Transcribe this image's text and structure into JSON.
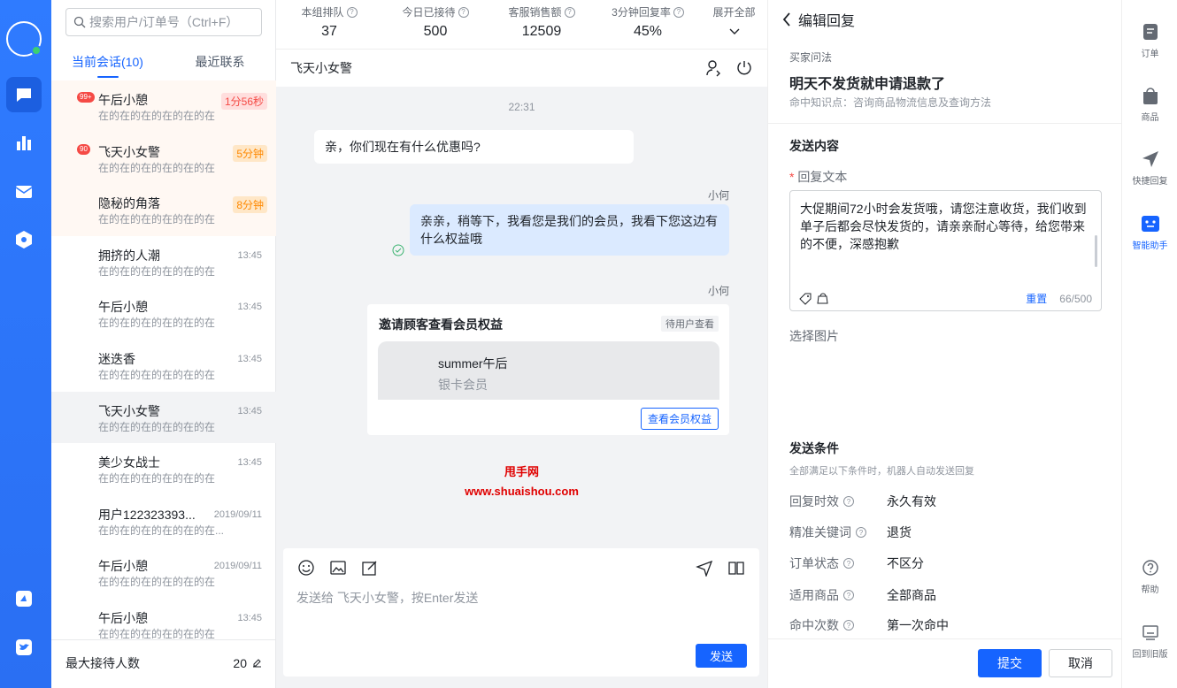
{
  "nav": {
    "icons": [
      "avatar",
      "chat-icon",
      "chart-icon",
      "mail-icon",
      "hexagon-icon",
      "app-icon",
      "bird-icon"
    ]
  },
  "conversations": {
    "search_placeholder": "搜索用户/订单号（Ctrl+F）",
    "tabs": [
      "当前会话(10)",
      "最近联系"
    ],
    "items": [
      {
        "badge": "99+",
        "name": "午后小憩",
        "sub": "在的在的在的在的在的在",
        "wait": "1分56秒",
        "wait_type": "red"
      },
      {
        "badge": "90",
        "name": "飞天小女警",
        "sub": "在的在的在的在的在的在",
        "wait": "5分钟",
        "wait_type": "orange"
      },
      {
        "name": "隐秘的角落",
        "sub": "在的在的在的在的在的在",
        "wait": "8分钟",
        "wait_type": "orange"
      },
      {
        "name": "拥挤的人潮",
        "sub": "在的在的在的在的在的在",
        "time": "13:45"
      },
      {
        "name": "午后小憩",
        "sub": "在的在的在的在的在的在",
        "time": "13:45"
      },
      {
        "name": "迷迭香",
        "sub": "在的在的在的在的在的在",
        "time": "13:45"
      },
      {
        "name": "飞天小女警",
        "sub": "在的在的在的在的在的在",
        "time": "13:45"
      },
      {
        "name": "美少女战士",
        "sub": "在的在的在的在的在的在",
        "time": "13:45"
      },
      {
        "name": "用户122323393...",
        "sub": "在的在的在的在的在的在...",
        "time": "2019/09/11"
      },
      {
        "name": "午后小憩",
        "sub": "在的在的在的在的在的在",
        "time": "2019/09/11"
      },
      {
        "name": "午后小憩",
        "sub": "在的在的在的在的在的在",
        "time": "13:45"
      }
    ],
    "footer_label": "最大接待人数",
    "footer_value": "20"
  },
  "stats": [
    {
      "label": "本组排队",
      "value": "37"
    },
    {
      "label": "今日已接待",
      "value": "500"
    },
    {
      "label": "客服销售额",
      "value": "12509"
    },
    {
      "label": "3分钟回复率",
      "value": "45%"
    }
  ],
  "expand_label": "展开全部",
  "chat": {
    "title": "飞天小女警",
    "time": "22:31",
    "msg_in": "亲，你们现在有什么优惠吗?",
    "sender": "小何",
    "msg_out": "亲亲，稍等下，我看您是我们的会员，我看下您这边有什么权益哦",
    "card": {
      "title": "邀请顾客查看会员权益",
      "status": "待用户查看",
      "name": "summer午后",
      "level": "银卡会员",
      "button": "查看会员权益"
    },
    "watermark_1": "甩手网",
    "watermark_2": "www.shuaishou.com",
    "input_placeholder": "发送给 飞天小女警，按Enter发送",
    "send_label": "发送"
  },
  "editor": {
    "title": "编辑回复",
    "question_label": "买家问法",
    "question": "明天不发货就申请退款了",
    "hit_knowledge": "命中知识点：咨询商品物流信息及查询方法",
    "send_content": "发送内容",
    "reply_label": "回复文本",
    "reply_text": "大促期间72小时会发货哦，请您注意收货，我们收到单子后都会尽快发货的，请亲亲耐心等待，给您带来的不便，深感抱歉",
    "reset": "重置",
    "count": "66/500",
    "select_image": "选择图片",
    "conditions_title": "发送条件",
    "conditions_sub": "全部满足以下条件时，机器人自动发送回复",
    "conditions": [
      {
        "k": "回复时效",
        "v": "永久有效"
      },
      {
        "k": "精准关键词",
        "v": "退货"
      },
      {
        "k": "订单状态",
        "v": "不区分"
      },
      {
        "k": "适用商品",
        "v": "全部商品"
      },
      {
        "k": "命中次数",
        "v": "第一次命中"
      }
    ],
    "submit": "提交",
    "cancel": "取消"
  },
  "rightbar": {
    "items": [
      "订单",
      "商品",
      "快捷回复",
      "智能助手",
      "帮助",
      "回到旧版"
    ]
  },
  "colors": {
    "accent": "#1664ff",
    "nav": "#2f7bff"
  }
}
